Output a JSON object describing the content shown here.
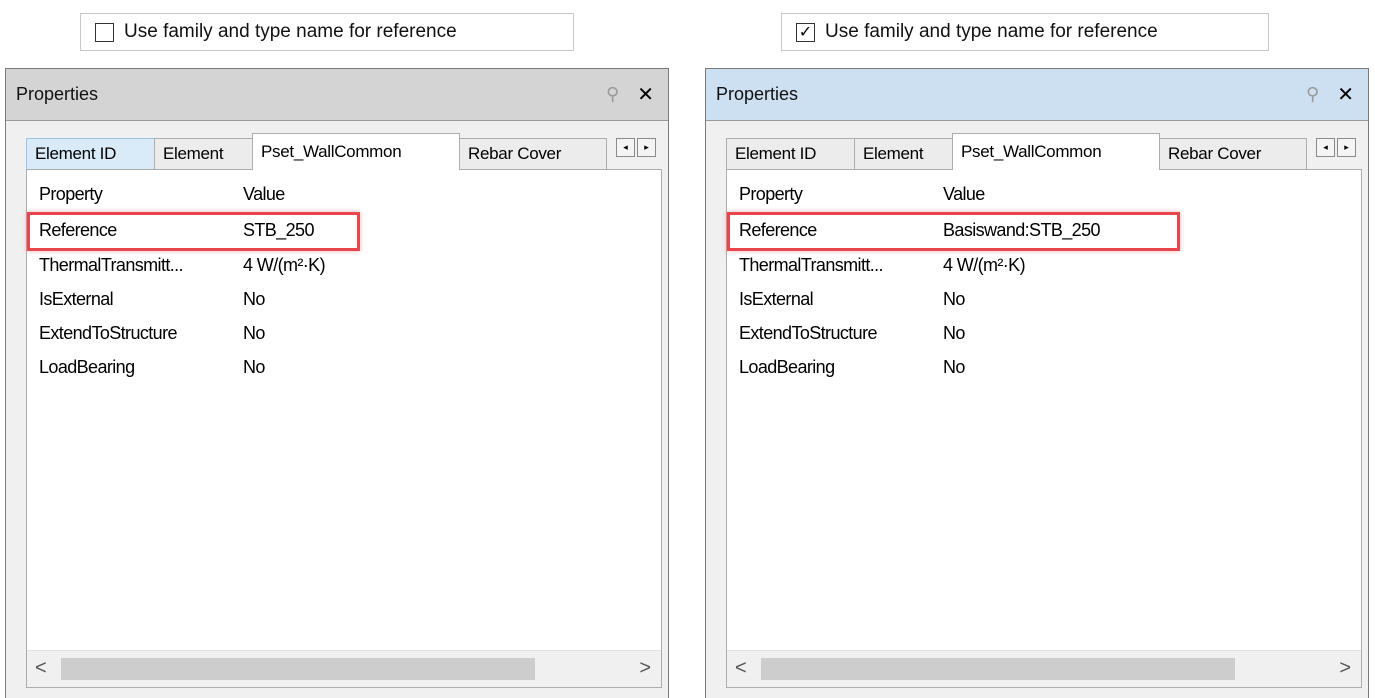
{
  "checkbox_left": {
    "label": "Use family and type name for reference",
    "checked": false
  },
  "checkbox_right": {
    "label": "Use family and type name for reference",
    "checked": true,
    "checkmark": "✓"
  },
  "panel_left": {
    "title": "Properties",
    "pin_glyph": "⚲",
    "close_glyph": "✕",
    "tabs": [
      "Element ID",
      "Element",
      "Pset_WallCommon",
      "Rebar Cover"
    ],
    "active_tab": "Pset_WallCommon",
    "scroll_left_glyph": "◂",
    "scroll_right_glyph": "▸",
    "headers": {
      "property": "Property",
      "value": "Value"
    },
    "rows": [
      {
        "property": "Reference",
        "value": "STB_250"
      },
      {
        "property": "ThermalTransmitt...",
        "value": "4 W/(m²·K)"
      },
      {
        "property": "IsExternal",
        "value": "No"
      },
      {
        "property": "ExtendToStructure",
        "value": "No"
      },
      {
        "property": "LoadBearing",
        "value": "No"
      }
    ],
    "hscroll_left": "<",
    "hscroll_right": ">"
  },
  "panel_right": {
    "title": "Properties",
    "pin_glyph": "⚲",
    "close_glyph": "✕",
    "tabs": [
      "Element ID",
      "Element",
      "Pset_WallCommon",
      "Rebar Cover"
    ],
    "active_tab": "Pset_WallCommon",
    "scroll_left_glyph": "◂",
    "scroll_right_glyph": "▸",
    "headers": {
      "property": "Property",
      "value": "Value"
    },
    "rows": [
      {
        "property": "Reference",
        "value": "Basiswand:STB_250"
      },
      {
        "property": "ThermalTransmitt...",
        "value": "4 W/(m²·K)"
      },
      {
        "property": "IsExternal",
        "value": "No"
      },
      {
        "property": "ExtendToStructure",
        "value": "No"
      },
      {
        "property": "LoadBearing",
        "value": "No"
      }
    ],
    "hscroll_left": "<",
    "hscroll_right": ">"
  },
  "colors": {
    "highlight": "#e8454c",
    "titlebar_inactive": "#d4d4d4",
    "titlebar_active": "#cde0f1"
  }
}
